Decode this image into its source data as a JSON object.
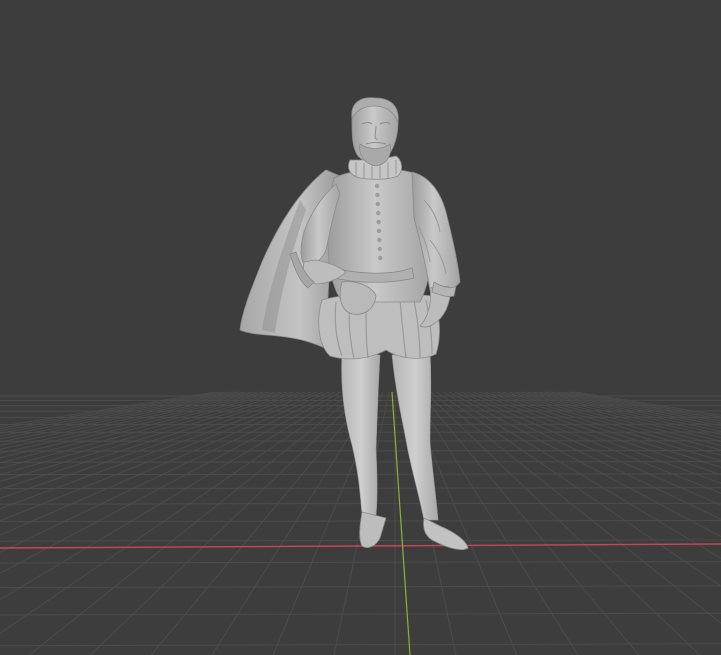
{
  "viewport": {
    "mode": "3d-viewport",
    "background_color": "#3d3d3d",
    "grid_line_color": "#4b4b4b",
    "x_axis_color": "#c4485c",
    "y_axis_color": "#8fb12f"
  },
  "scene": {
    "object_icon": "statue-mesh-icon",
    "object_material_color": "#b7b7b7",
    "shading": "solid"
  }
}
